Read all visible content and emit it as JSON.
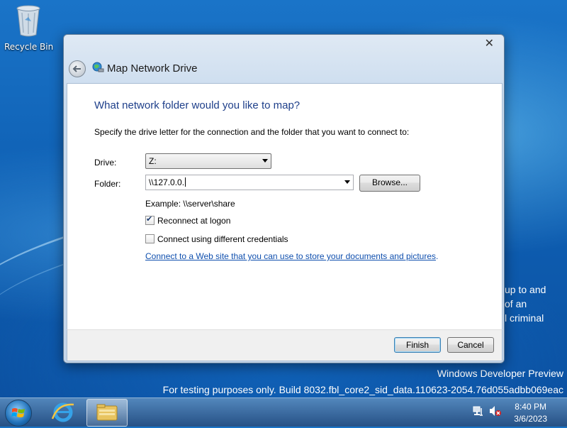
{
  "desktop": {
    "recycle_bin_label": "Recycle Bin",
    "background_text": [
      "up to and",
      "of an",
      "l criminal"
    ],
    "watermark_line1": "Windows Developer Preview",
    "watermark_line2": "For testing purposes only. Build 8032.fbl_core2_sid_data.110623-2054.76d055adbb069eac"
  },
  "dialog": {
    "title": "Map Network Drive",
    "heading": "What network folder would you like to map?",
    "description": "Specify the drive letter for the connection and the folder that you want to connect to:",
    "drive_label": "Drive:",
    "drive_value": "Z:",
    "folder_label": "Folder:",
    "folder_value": "\\\\127.0.0.",
    "browse_label": "Browse...",
    "example_text": "Example: \\\\server\\share",
    "reconnect_label": "Reconnect at logon",
    "reconnect_checked": true,
    "credentials_label": "Connect using different credentials",
    "credentials_checked": false,
    "link_text": "Connect to a Web site that you can use to store your documents and pictures",
    "link_suffix": ".",
    "finish_label": "Finish",
    "cancel_label": "Cancel"
  },
  "taskbar": {
    "time": "8:40 PM",
    "date": "3/6/2023"
  }
}
